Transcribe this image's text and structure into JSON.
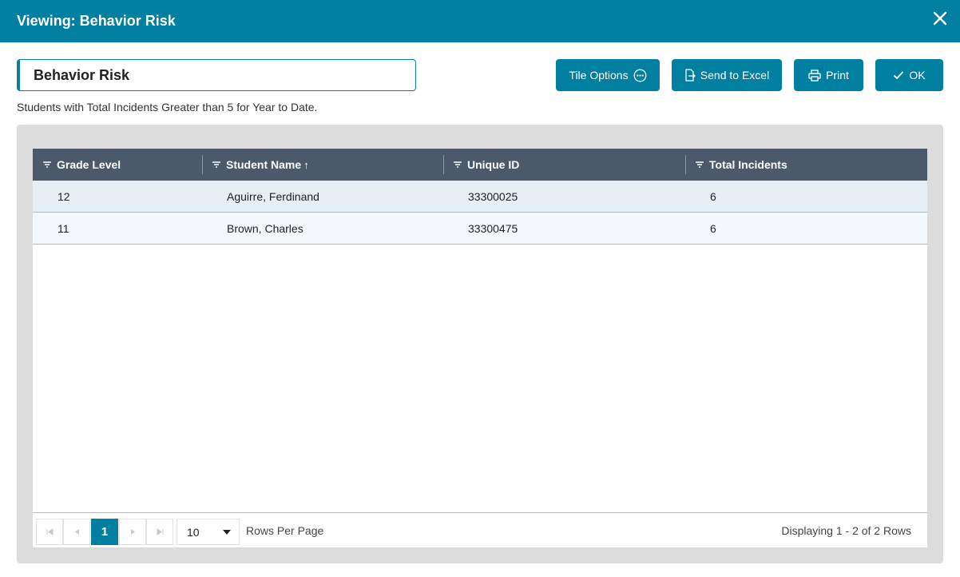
{
  "dialog": {
    "title": "Viewing: Behavior Risk"
  },
  "tile": {
    "title_value": "Behavior Risk",
    "description": "Students with Total Incidents Greater than 5 for Year to Date."
  },
  "toolbar": {
    "tile_options_label": "Tile Options",
    "send_to_excel_label": "Send to Excel",
    "print_label": "Print",
    "ok_label": "OK"
  },
  "grid": {
    "columns": [
      {
        "label": "Grade Level"
      },
      {
        "label": "Student Name",
        "sort": "ascending"
      },
      {
        "label": "Unique ID"
      },
      {
        "label": "Total Incidents"
      }
    ],
    "rows": [
      {
        "grade": "12",
        "name": "Aguirre, Ferdinand",
        "id": "33300025",
        "incidents": "6"
      },
      {
        "grade": "11",
        "name": "Brown, Charles",
        "id": "33300475",
        "incidents": "6"
      }
    ],
    "sort_indicator": "↑"
  },
  "pager": {
    "current_page": "1",
    "rows_per_page_value": "10",
    "rows_per_page_label": "Rows Per Page",
    "display_text": "Displaying 1 - 2 of 2 Rows"
  },
  "colors": {
    "accent": "#007fa0",
    "header_bg": "#4a5a6a",
    "row_alt_1": "#e6eef6",
    "row_alt_2": "#f4f8fc"
  }
}
